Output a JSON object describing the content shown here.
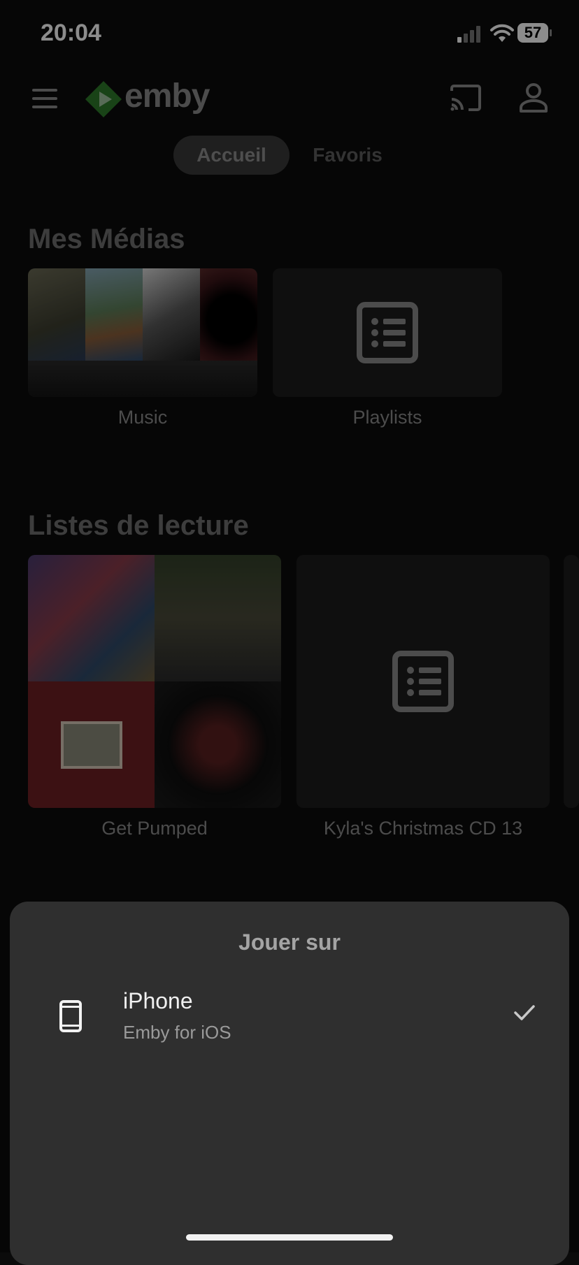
{
  "status": {
    "time": "20:04",
    "battery": "57"
  },
  "header": {
    "logo_text": "emby"
  },
  "tabs": [
    {
      "label": "Accueil"
    },
    {
      "label": "Favoris"
    }
  ],
  "sections": {
    "media": {
      "title": "Mes Médias",
      "items": [
        {
          "label": "Music"
        },
        {
          "label": "Playlists"
        }
      ]
    },
    "playlists": {
      "title": "Listes de lecture",
      "items": [
        {
          "label": "Get Pumped"
        },
        {
          "label": "Kyla's Christmas CD 13"
        }
      ]
    }
  },
  "sheet": {
    "title": "Jouer sur",
    "device": {
      "name": "iPhone",
      "subtitle": "Emby for iOS"
    }
  },
  "colors": {
    "brand_green": "#52b54b",
    "sheet_bg": "#2f2f2f"
  }
}
